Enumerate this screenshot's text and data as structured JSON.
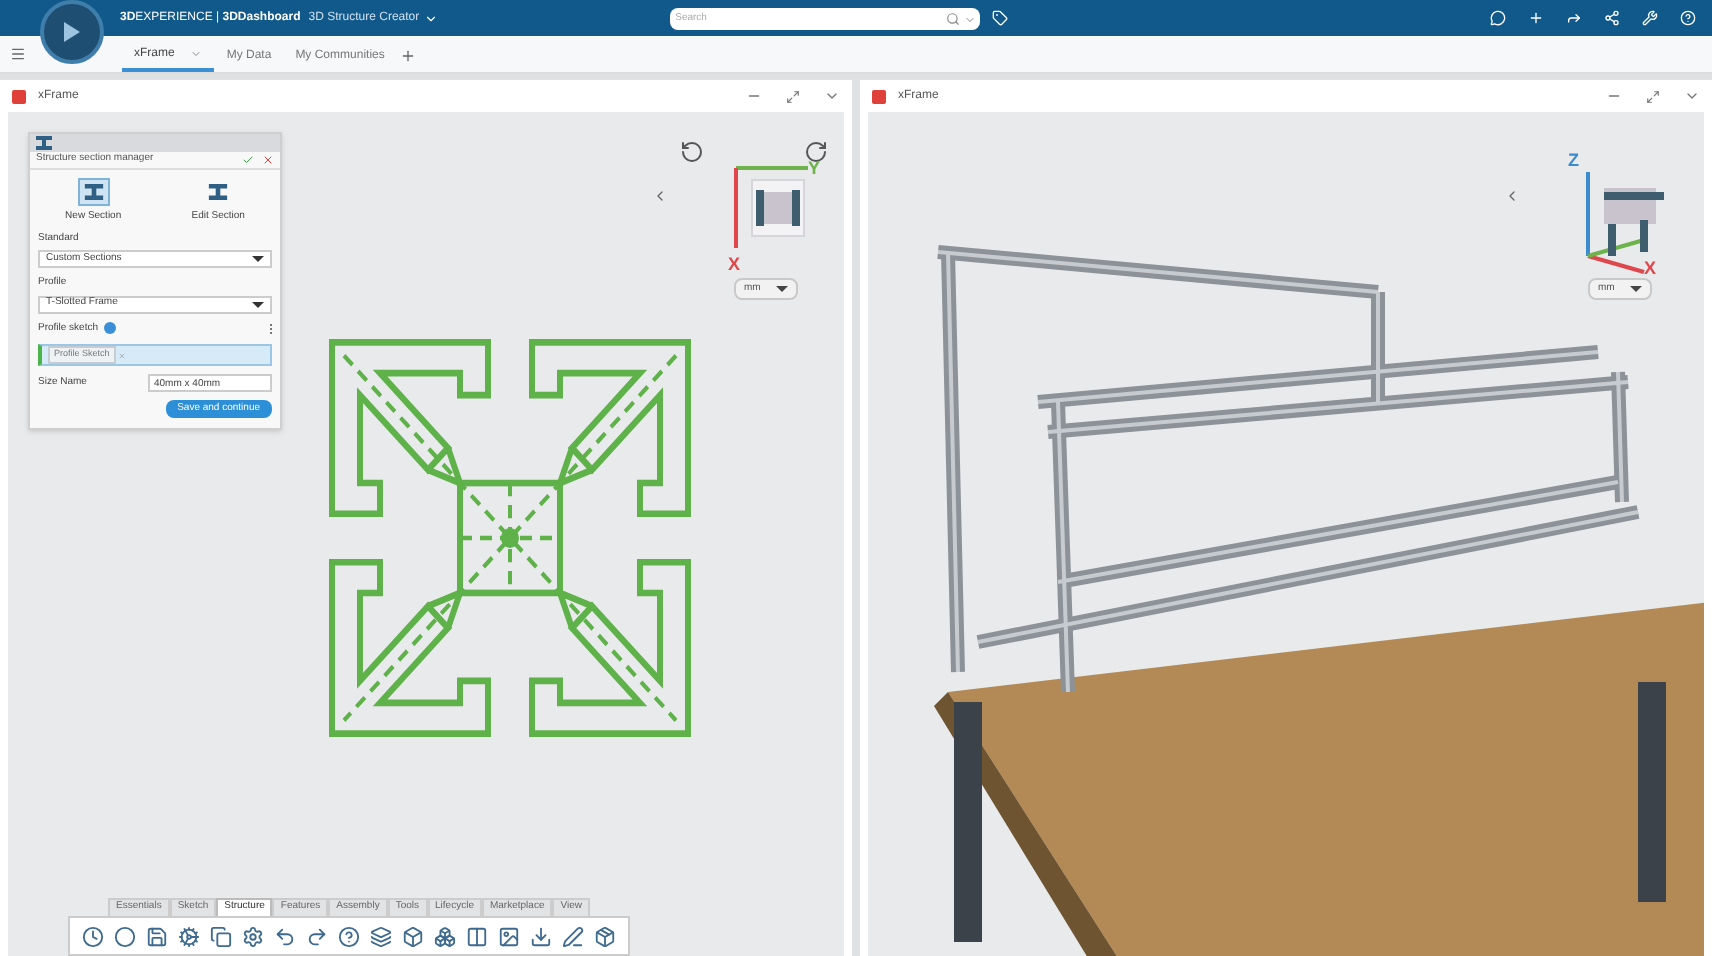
{
  "top_bar": {
    "brand": "**3D**EXPERIENCE | **3DDashboard**",
    "app": "3D Structure Creator",
    "search": {
      "placeholder": "Search"
    }
  },
  "tabs": [
    {
      "label": "xFrame",
      "selected": true
    },
    {
      "label": "My Data",
      "selected": false
    },
    {
      "label": "My Communities",
      "selected": false
    }
  ],
  "panels": [
    {
      "title": "xFrame",
      "unit": "mm",
      "axes": [
        "Y",
        "X"
      ]
    },
    {
      "title": "xFrame",
      "unit": "mm",
      "axes": [
        "Z",
        "X"
      ]
    }
  ],
  "dialog": {
    "title": "Structure section manager",
    "modes": [
      {
        "label": "New Section",
        "selected": true
      },
      {
        "label": "Edit Section",
        "selected": false
      }
    ],
    "standard": {
      "label": "Standard",
      "value": "Custom Sections"
    },
    "profile": {
      "label": "Profile",
      "value": "T-Slotted Frame"
    },
    "sketch": {
      "label": "Profile sketch",
      "chip": "Profile Sketch"
    },
    "size": {
      "label": "Size Name",
      "value": "40mm x 40mm"
    },
    "button": "Save and continue"
  },
  "toolbar_tabs": [
    {
      "label": "Essentials",
      "selected": false
    },
    {
      "label": "Sketch",
      "selected": false
    },
    {
      "label": "Structure",
      "selected": true
    },
    {
      "label": "Features",
      "selected": false
    },
    {
      "label": "Assembly",
      "selected": false
    },
    {
      "label": "Tools",
      "selected": false
    },
    {
      "label": "Lifecycle",
      "selected": false
    },
    {
      "label": "Marketplace",
      "selected": false
    },
    {
      "label": "View",
      "selected": false
    }
  ]
}
